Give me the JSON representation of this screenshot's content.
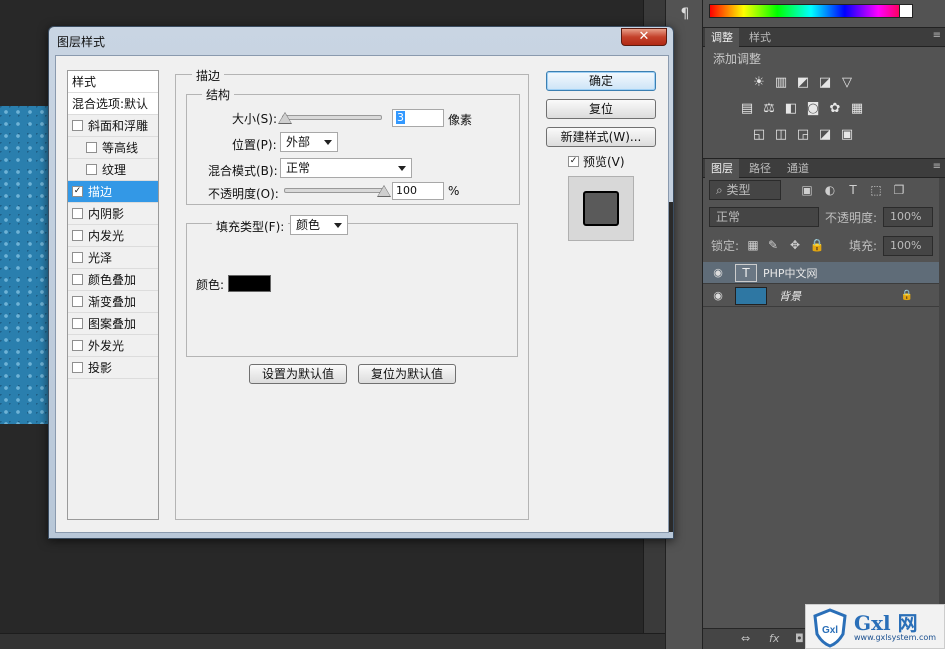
{
  "app": {
    "workspace_para_icon": "¶"
  },
  "panels": {
    "adjust_tabs": [
      "调整",
      "样式"
    ],
    "adjust_title": "添加调整",
    "adjust_icons_row1": [
      "☀",
      "▥",
      "◩",
      "◪",
      "▽"
    ],
    "adjust_icons_row2": [
      "▤",
      "⚖",
      "◧",
      "◙",
      "✿",
      "▦"
    ],
    "adjust_icons_row3": [
      "◱",
      "◫",
      "◲",
      "◪",
      "▣"
    ],
    "layers_tabs": [
      "图层",
      "路径",
      "通道"
    ],
    "filter_kind": "类型",
    "blend_mode": "正常",
    "opacity_label": "不透明度:",
    "opacity_value": "100%",
    "lock_label": "锁定:",
    "fill_label": "填充:",
    "fill_value": "100%",
    "layers": [
      {
        "name": "PHP中文网",
        "type": "text",
        "thumb": "T",
        "selected": true
      },
      {
        "name": "背景",
        "type": "image",
        "locked": true,
        "selected": false
      }
    ],
    "footer_icons": [
      "⇔",
      "fx",
      "◘"
    ]
  },
  "dialog": {
    "title": "图层样式",
    "close": "✕",
    "style_list": {
      "header": "样式",
      "blend_options": "混合选项:默认",
      "items": [
        {
          "label": "斜面和浮雕",
          "checked": false,
          "indent": false
        },
        {
          "label": "等高线",
          "checked": false,
          "indent": true
        },
        {
          "label": "纹理",
          "checked": false,
          "indent": true
        },
        {
          "label": "描边",
          "checked": true,
          "indent": false,
          "selected": true
        },
        {
          "label": "内阴影",
          "checked": false,
          "indent": false
        },
        {
          "label": "内发光",
          "checked": false,
          "indent": false
        },
        {
          "label": "光泽",
          "checked": false,
          "indent": false
        },
        {
          "label": "颜色叠加",
          "checked": false,
          "indent": false
        },
        {
          "label": "渐变叠加",
          "checked": false,
          "indent": false
        },
        {
          "label": "图案叠加",
          "checked": false,
          "indent": false
        },
        {
          "label": "外发光",
          "checked": false,
          "indent": false
        },
        {
          "label": "投影",
          "checked": false,
          "indent": false
        }
      ]
    },
    "stroke": {
      "group_title": "描边",
      "structure_title": "结构",
      "size_label": "大小(S):",
      "size_value": "3",
      "size_level": 0.03,
      "size_unit": "像素",
      "position_label": "位置(P):",
      "position_value": "外部",
      "blend_label": "混合模式(B):",
      "blend_value": "正常",
      "opacity_label": "不透明度(O):",
      "opacity_value": "100",
      "opacity_level": 1.0,
      "opacity_unit": "%",
      "fill_type_label": "填充类型(F):",
      "fill_type_value": "颜色",
      "color_label": "颜色:",
      "color": "#000000",
      "set_default": "设置为默认值",
      "reset_default": "复位为默认值"
    },
    "buttons": {
      "ok": "确定",
      "reset": "复位",
      "new_style": "新建样式(W)...",
      "preview": "预览(V)",
      "preview_checked": true
    }
  },
  "watermark": {
    "brand": "Gxl 网",
    "url": "www.gxlsystem.com",
    "shield_text": "Gxl"
  }
}
